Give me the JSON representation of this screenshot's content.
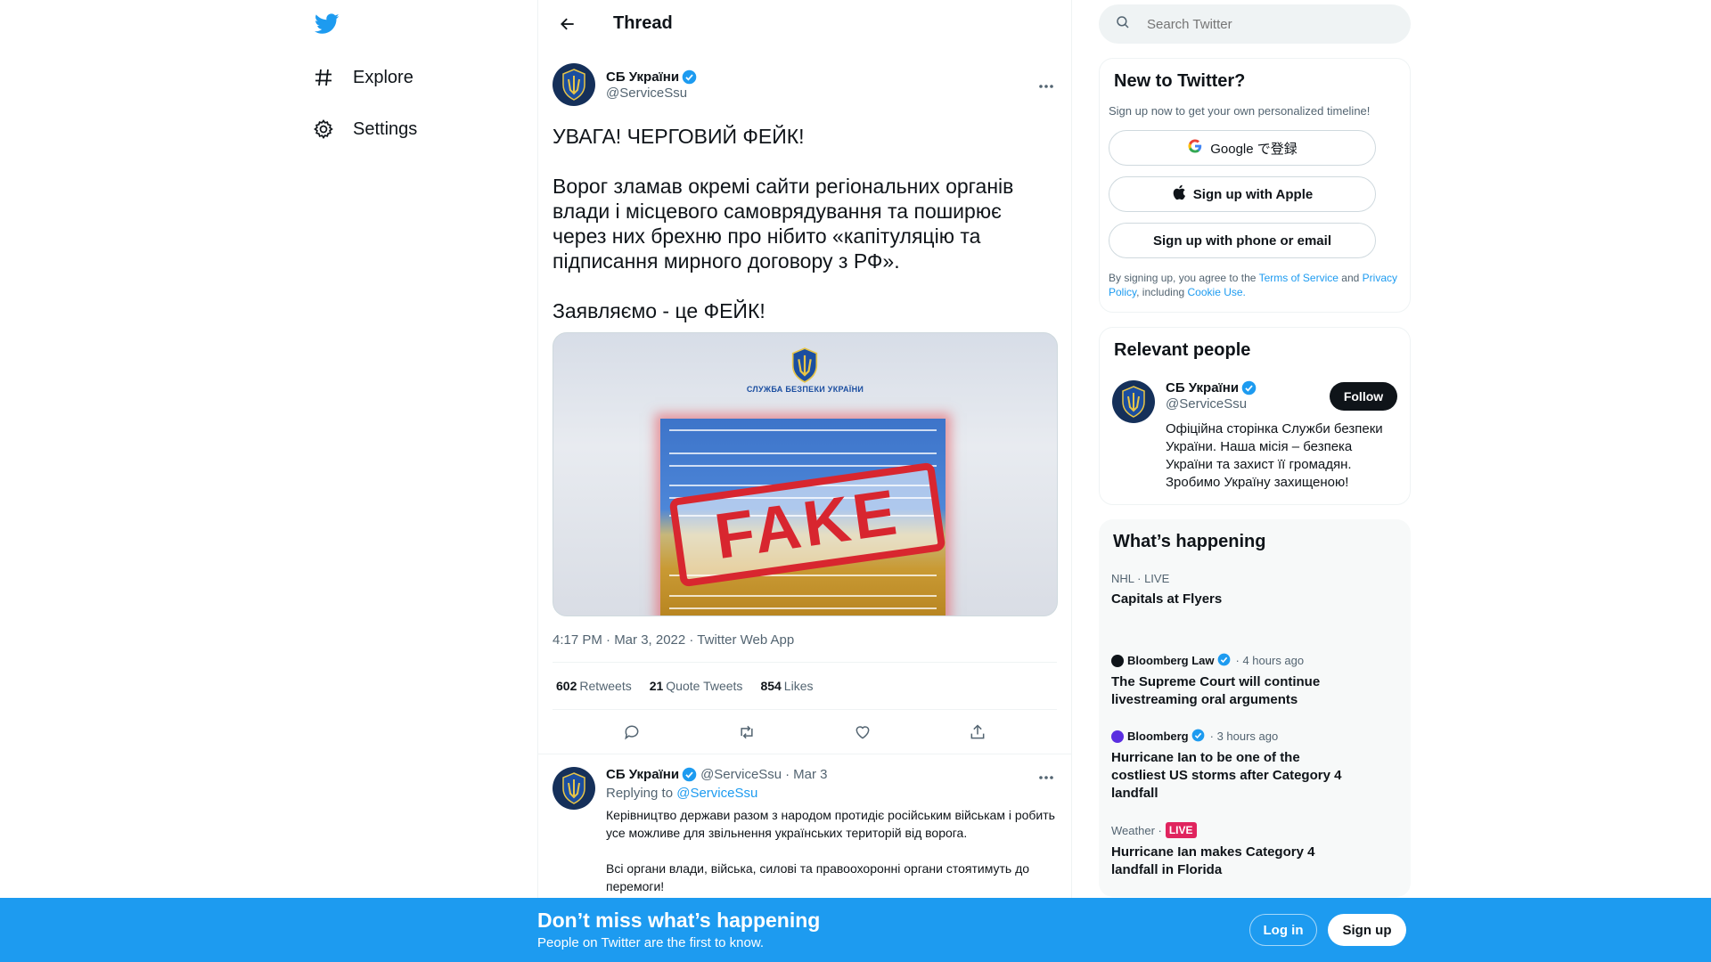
{
  "colors": {
    "accent": "#1d9bf0",
    "text": "#0f1419",
    "muted": "#536471"
  },
  "nav": {
    "logo_icon": "twitter-bird-icon",
    "items": [
      {
        "label": "Explore",
        "icon": "hash-icon"
      },
      {
        "label": "Settings",
        "icon": "gear-icon"
      }
    ]
  },
  "thread": {
    "title": "Thread",
    "tweet": {
      "author": "СБ України",
      "handle": "@ServiceSsu",
      "text": "УВАГА! ЧЕРГОВИЙ ФЕЙК!\n\nВорог зламав окремі сайти регіональних органів влади і місцевого самоврядування та поширює через них брехню про нібито «капітуляцію та підписання мирного договору з РФ».\n\nЗаявляємо - це ФЕЙК!",
      "media": {
        "caption": "СЛУЖБА БЕЗПЕКИ УКРАЇНИ",
        "stamp": "FAKE"
      },
      "meta": "4:17 PM · Mar 3, 2022 · Twitter Web App",
      "stats": {
        "retweets_count": "602",
        "retweets_label": "Retweets",
        "quotes_count": "21",
        "quotes_label": "Quote Tweets",
        "likes_count": "854",
        "likes_label": "Likes"
      }
    },
    "reply": {
      "author": "СБ України",
      "handle": "@ServiceSsu",
      "separator": "·",
      "date": "Mar 3",
      "replying_prefix": "Replying to",
      "replying_handle": "@ServiceSsu",
      "text": "Керівництво держави разом з народом протидіє російським військам і робить усе можливе для звільнення українських територій від ворога.\n\nВсі органи влади, війська, силові та правоохоронні органи стоятимуть до перемоги!"
    }
  },
  "search": {
    "placeholder": "Search Twitter"
  },
  "signup": {
    "title": "New to Twitter?",
    "subtitle": "Sign up now to get your own personalized timeline!",
    "google": "Google で登録",
    "apple": "Sign up with Apple",
    "phone": "Sign up with phone or email",
    "legal_prefix": "By signing up, you agree to the",
    "terms": "Terms of Service",
    "and": "and",
    "privacy": "Privacy Policy",
    "including": ", including",
    "cookie": "Cookie Use."
  },
  "relevant": {
    "title": "Relevant people",
    "name": "СБ України",
    "handle": "@ServiceSsu",
    "follow": "Follow",
    "bio": "Офіційна сторінка Служби безпеки України. Наша місія – безпека України та захист її громадян. Зробимо Україну захищеною!"
  },
  "happening": {
    "title": "What’s happening",
    "trends": [
      {
        "meta": "NHL · LIVE",
        "title": "Capitals at Flyers"
      },
      {
        "source": "Bloomberg Law",
        "time": "· 4 hours ago",
        "title": "The Supreme Court will continue livestreaming oral arguments"
      },
      {
        "source": "Bloomberg",
        "time": "· 3 hours ago",
        "title": "Hurricane Ian to be one of the costliest US storms after Category 4 landfall"
      },
      {
        "meta": "Weather ·",
        "badge": "LIVE",
        "title": "Hurricane Ian makes Category 4 landfall in Florida"
      }
    ]
  },
  "bottom_bar": {
    "title": "Don’t miss what’s happening",
    "subtitle": "People on Twitter are the first to know.",
    "login": "Log in",
    "signup": "Sign up"
  }
}
